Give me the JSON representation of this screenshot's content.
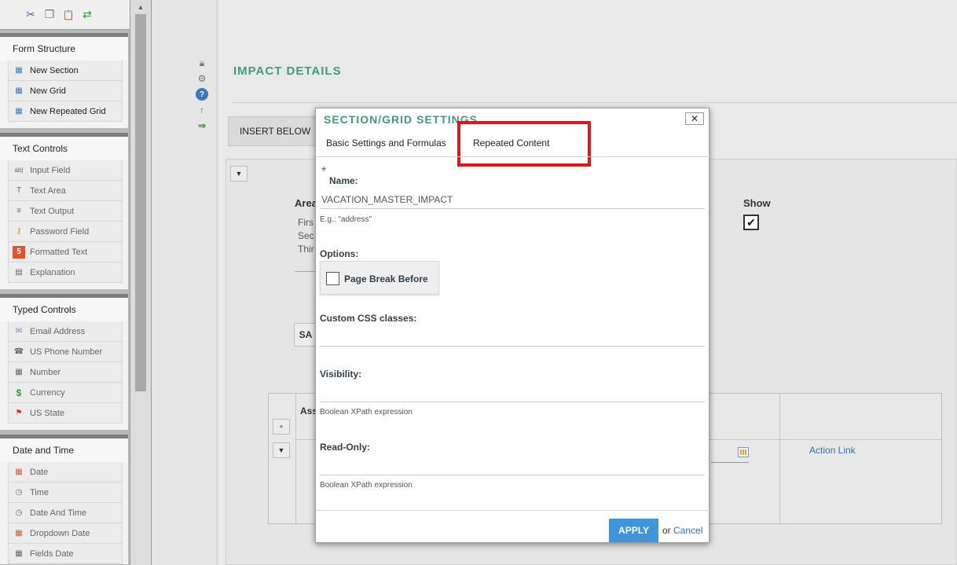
{
  "toolbox": {
    "top_tools": [
      {
        "icon": "cut-icon",
        "glyph": "✂"
      },
      {
        "icon": "copy-icon",
        "glyph": "❐"
      },
      {
        "icon": "paste-icon",
        "glyph": "📋"
      },
      {
        "icon": "refresh-icon",
        "glyph": "⇄"
      }
    ],
    "sections": [
      {
        "title": "Form Structure",
        "items": [
          {
            "label": "New Section",
            "icon": "section-icon",
            "glyph": "▦"
          },
          {
            "label": "New Grid",
            "icon": "grid-icon",
            "glyph": "▦"
          },
          {
            "label": "New Repeated Grid",
            "icon": "repeated-grid-icon",
            "glyph": "▦"
          }
        ]
      },
      {
        "title": "Text Controls",
        "items": [
          {
            "label": "Input Field",
            "icon": "input-field-icon",
            "glyph": "ab|"
          },
          {
            "label": "Text Area",
            "icon": "text-area-icon",
            "glyph": "T"
          },
          {
            "label": "Text Output",
            "icon": "text-output-icon",
            "glyph": "≡"
          },
          {
            "label": "Password Field",
            "icon": "key-icon",
            "glyph": "⚷"
          },
          {
            "label": "Formatted Text",
            "icon": "html5-icon",
            "glyph": "5"
          },
          {
            "label": "Explanation",
            "icon": "explanation-icon",
            "glyph": "▤"
          }
        ]
      },
      {
        "title": "Typed Controls",
        "items": [
          {
            "label": "Email Address",
            "icon": "envelope-icon",
            "glyph": "✉"
          },
          {
            "label": "US Phone Number",
            "icon": "phone-icon",
            "glyph": "☎"
          },
          {
            "label": "Number",
            "icon": "calculator-icon",
            "glyph": "▦"
          },
          {
            "label": "Currency",
            "icon": "dollar-icon",
            "glyph": "$"
          },
          {
            "label": "US State",
            "icon": "us-flag-icon",
            "glyph": "⚑"
          }
        ]
      },
      {
        "title": "Date and Time",
        "items": [
          {
            "label": "Date",
            "icon": "calendar-icon",
            "glyph": "▦"
          },
          {
            "label": "Time",
            "icon": "clock-icon",
            "glyph": "◷"
          },
          {
            "label": "Date And Time",
            "icon": "date-time-icon",
            "glyph": "◷"
          },
          {
            "label": "Dropdown Date",
            "icon": "dropdown-date-icon",
            "glyph": "▦"
          },
          {
            "label": "Fields Date",
            "icon": "fields-date-icon",
            "glyph": "▦"
          }
        ]
      }
    ]
  },
  "editor": {
    "section_title": "IMPACT DETAILS",
    "insert_below_label": "INSERT BELOW",
    "background_texts": {
      "area": "Area",
      "line1": "Firs",
      "line2": "Sec",
      "line3": "Thir",
      "show": "Show",
      "save_partial": "SA",
      "assoc_partial": "Ass",
      "action_link": "Action Link",
      "plus": "+",
      "show_checkmark": "✔"
    }
  },
  "dialog": {
    "title": "SECTION/GRID SETTINGS",
    "close_glyph": "✕",
    "tabs": [
      {
        "label": "Basic Settings and Formulas",
        "active": true
      },
      {
        "label": "Repeated Content",
        "active": false,
        "highlighted": true
      }
    ],
    "highlight_color": "#e3141c",
    "required_marker": "*",
    "name_label": "Name:",
    "name_value": "VACATION_MASTER_IMPACT",
    "name_hint": "E.g.: \"address\"",
    "options_label": "Options:",
    "page_break_label": "Page Break Before",
    "page_break_checked": false,
    "css_label": "Custom CSS classes:",
    "css_value": "",
    "visibility_label": "Visibility:",
    "visibility_value": "",
    "visibility_hint": "Boolean XPath expression",
    "readonly_label": "Read-Only:",
    "readonly_value": "",
    "readonly_hint": "Boolean XPath expression",
    "apply_label": "APPLY",
    "or_text": "or",
    "cancel_label": "Cancel",
    "accent_color": "#44997e",
    "apply_color": "#3d95da"
  }
}
